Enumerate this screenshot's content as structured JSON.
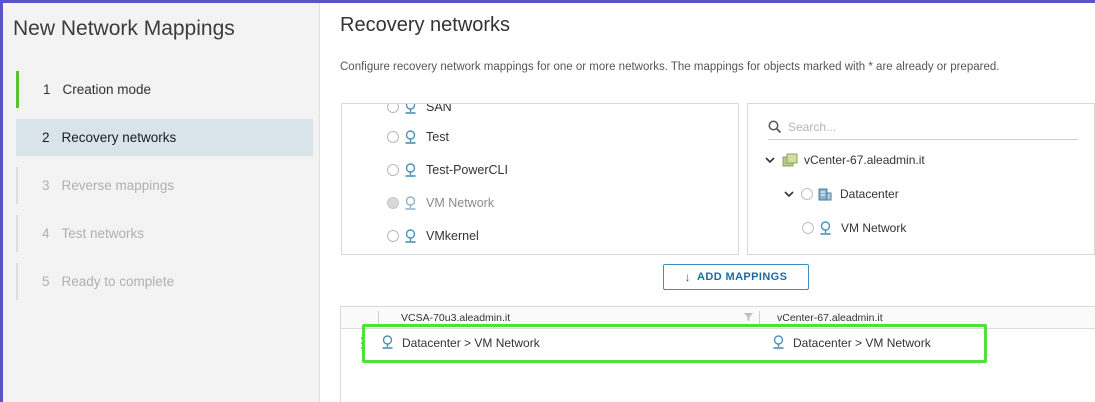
{
  "wizard": {
    "title": "New Network Mappings",
    "steps": [
      {
        "num": "1",
        "label": "Creation mode"
      },
      {
        "num": "2",
        "label": "Recovery networks"
      },
      {
        "num": "3",
        "label": "Reverse mappings"
      },
      {
        "num": "4",
        "label": "Test networks"
      },
      {
        "num": "5",
        "label": "Ready to complete"
      }
    ]
  },
  "page": {
    "title": "Recovery networks",
    "description": "Configure recovery network mappings for one or more networks. The mappings for objects marked with * are already or prepared."
  },
  "source_networks": [
    {
      "label": "SAN"
    },
    {
      "label": "Test"
    },
    {
      "label": "Test-PowerCLI"
    },
    {
      "label": "VM Network"
    },
    {
      "label": "VMkernel"
    }
  ],
  "target_tree": {
    "search_placeholder": "Search...",
    "vcenter": "vCenter-67.aleadmin.it",
    "datacenter": "Datacenter",
    "network": "VM Network"
  },
  "add_button_label": "ADD MAPPINGS",
  "mapping_grid": {
    "columns": [
      "VCSA-70u3.aleadmin.it",
      "vCenter-67.aleadmin.it"
    ],
    "rows": [
      {
        "source": "Datacenter > VM Network",
        "target": "Datacenter > VM Network"
      }
    ]
  },
  "colors": {
    "highlight": "#4fe03a",
    "active_step": "#d9e4ea",
    "accent_blue": "#1c6b9e",
    "step_done": "#5dc12e"
  },
  "icons": [
    "network-icon",
    "search-icon",
    "chevron-down-icon",
    "vcenter-icon",
    "datacenter-icon",
    "filter-icon",
    "drag-handle-icon",
    "arrow-down-icon"
  ]
}
